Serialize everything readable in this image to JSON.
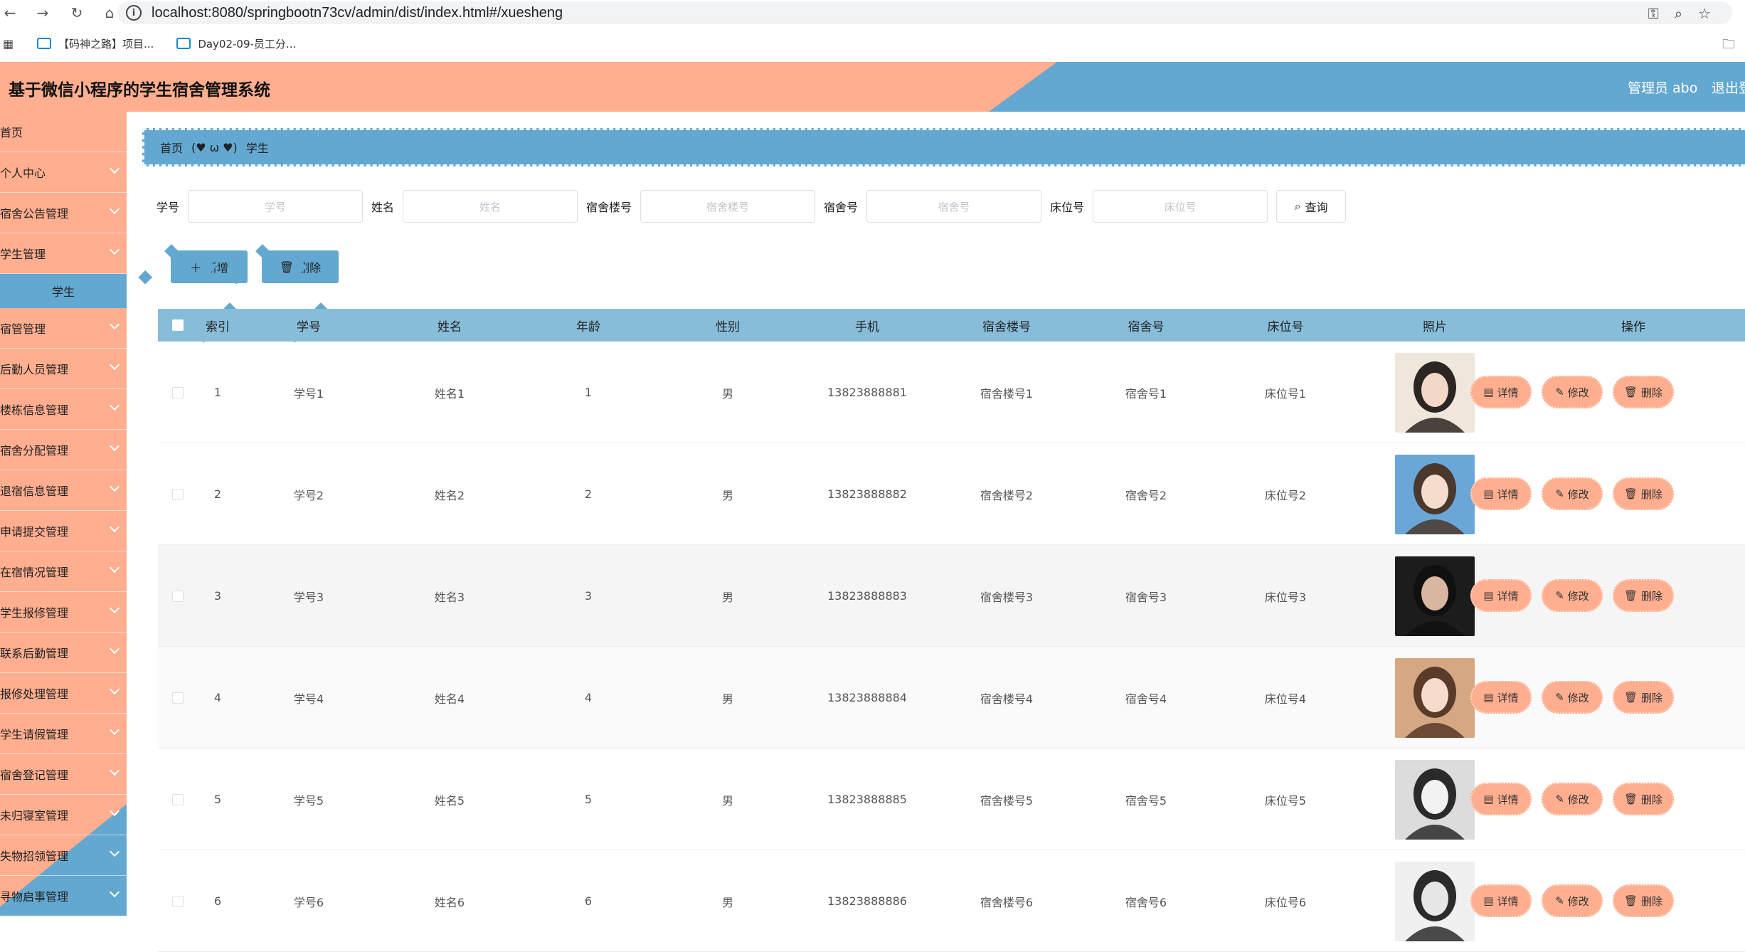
{
  "browser": {
    "url": "localhost:8080/springbootn73cv/admin/dist/index.html#/xuesheng",
    "bookmarks": [
      "【码神之路】项目...",
      "Day02-09-员工分..."
    ]
  },
  "header": {
    "title": "基于微信小程序的学生宿舍管理系统",
    "admin": "管理员 abo",
    "logout": "退出登"
  },
  "sidebar": {
    "items": [
      {
        "label": "首页",
        "chevron": false
      },
      {
        "label": "个人中心",
        "chevron": true
      },
      {
        "label": "宿舍公告管理",
        "chevron": true
      },
      {
        "label": "学生管理",
        "chevron": true
      },
      {
        "label": "学生",
        "sub": true
      },
      {
        "label": "宿管管理",
        "chevron": true
      },
      {
        "label": "后勤人员管理",
        "chevron": true
      },
      {
        "label": "楼栋信息管理",
        "chevron": true
      },
      {
        "label": "宿舍分配管理",
        "chevron": true
      },
      {
        "label": "退宿信息管理",
        "chevron": true
      },
      {
        "label": "申请提交管理",
        "chevron": true
      },
      {
        "label": "在宿情况管理",
        "chevron": true
      },
      {
        "label": "学生报修管理",
        "chevron": true
      },
      {
        "label": "联系后勤管理",
        "chevron": true
      },
      {
        "label": "报修处理管理",
        "chevron": true
      },
      {
        "label": "学生请假管理",
        "chevron": true
      },
      {
        "label": "宿舍登记管理",
        "chevron": true
      },
      {
        "label": "未归寝室管理",
        "chevron": true
      },
      {
        "label": "失物招领管理",
        "chevron": true
      },
      {
        "label": "寻物启事管理",
        "chevron": true
      }
    ]
  },
  "breadcrumb": {
    "home": "首页",
    "separator": "(♥ ω ♥)",
    "current": "学生"
  },
  "search": {
    "fields": [
      {
        "label": "学号",
        "placeholder": "学号"
      },
      {
        "label": "姓名",
        "placeholder": "姓名"
      },
      {
        "label": "宿舍楼号",
        "placeholder": "宿舍楼号"
      },
      {
        "label": "宿舍号",
        "placeholder": "宿舍号"
      },
      {
        "label": "床位号",
        "placeholder": "床位号"
      }
    ],
    "query_label": "查询"
  },
  "actions": {
    "add_label": "新增",
    "delete_label": "删除"
  },
  "table": {
    "columns": [
      "索引",
      "学号",
      "姓名",
      "年龄",
      "性别",
      "手机",
      "宿舍楼号",
      "宿舍号",
      "床位号",
      "照片",
      "操作"
    ],
    "row_actions": {
      "detail": "详情",
      "edit": "修改",
      "delete": "删除"
    },
    "rows": [
      {
        "index": "1",
        "xuehao": "学号1",
        "name": "姓名1",
        "age": "1",
        "gender": "男",
        "phone": "13823888881",
        "building": "宿舍楼号1",
        "room": "宿舍号1",
        "bed": "床位号1"
      },
      {
        "index": "2",
        "xuehao": "学号2",
        "name": "姓名2",
        "age": "2",
        "gender": "男",
        "phone": "13823888882",
        "building": "宿舍楼号2",
        "room": "宿舍号2",
        "bed": "床位号2"
      },
      {
        "index": "3",
        "xuehao": "学号3",
        "name": "姓名3",
        "age": "3",
        "gender": "男",
        "phone": "13823888883",
        "building": "宿舍楼号3",
        "room": "宿舍号3",
        "bed": "床位号3"
      },
      {
        "index": "4",
        "xuehao": "学号4",
        "name": "姓名4",
        "age": "4",
        "gender": "男",
        "phone": "13823888884",
        "building": "宿舍楼号4",
        "room": "宿舍号4",
        "bed": "床位号4"
      },
      {
        "index": "5",
        "xuehao": "学号5",
        "name": "姓名5",
        "age": "5",
        "gender": "男",
        "phone": "13823888885",
        "building": "宿舍楼号5",
        "room": "宿舍号5",
        "bed": "床位号5"
      },
      {
        "index": "6",
        "xuehao": "学号6",
        "name": "姓名6",
        "age": "6",
        "gender": "男",
        "phone": "13823888886",
        "building": "宿舍楼号6",
        "room": "宿舍号6",
        "bed": "床位号6"
      }
    ]
  },
  "colors": {
    "salmon": "#ffae8f",
    "blue": "#63a8d0",
    "header_blue": "#87bdd9"
  }
}
